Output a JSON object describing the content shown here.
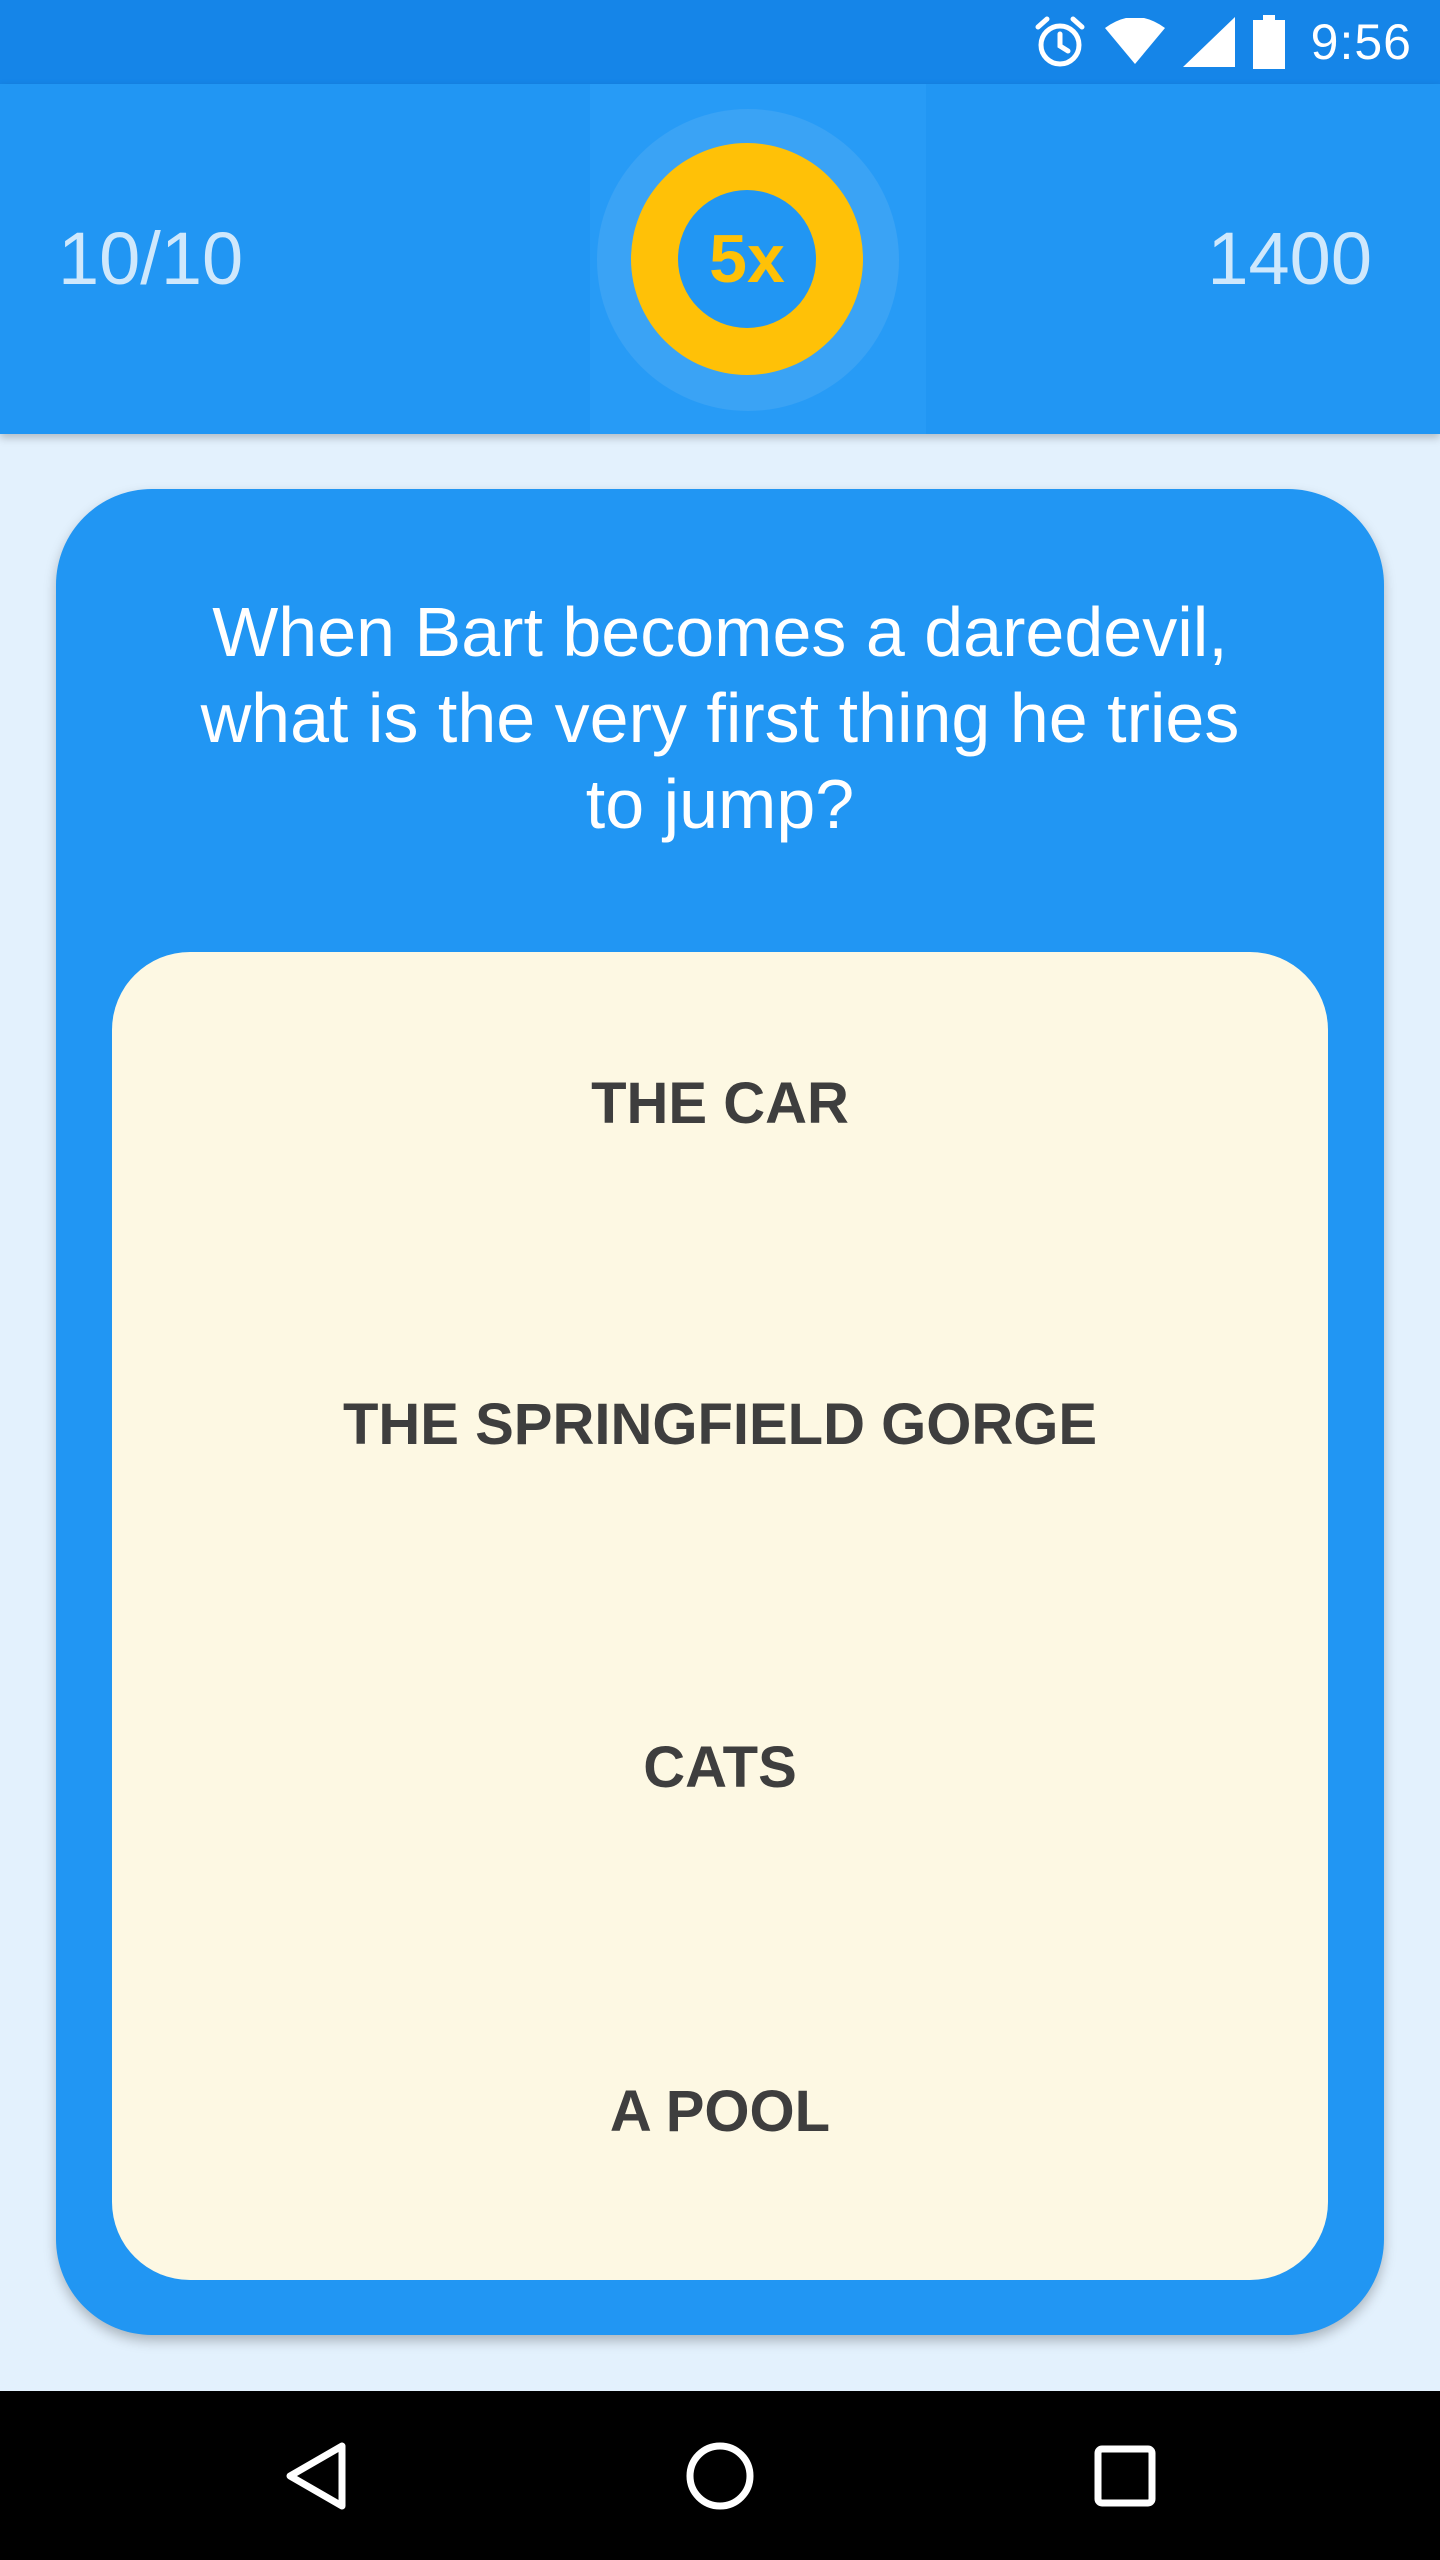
{
  "status_bar": {
    "time": "9:56",
    "icons": [
      "alarm-icon",
      "wifi-icon",
      "cell-signal-icon",
      "battery-icon"
    ]
  },
  "quiz_header": {
    "progress": "10/10",
    "multiplier": "5x",
    "score": "1400"
  },
  "question": {
    "text": "When Bart becomes a daredevil, what is the very first thing he tries to jump?"
  },
  "answers": [
    {
      "label": "THE CAR"
    },
    {
      "label": "THE SPRINGFIELD GORGE"
    },
    {
      "label": "CATS"
    },
    {
      "label": "A POOL"
    }
  ],
  "navigation": {
    "icons": [
      "back-icon",
      "home-icon",
      "recents-icon"
    ]
  },
  "colors": {
    "primary": "#2196f3",
    "status_bar": "#1585e8",
    "accent": "#ffc107",
    "background": "#e3f1fd",
    "answer_panel": "#fdf8e3",
    "answer_text": "#3e3e3e"
  }
}
